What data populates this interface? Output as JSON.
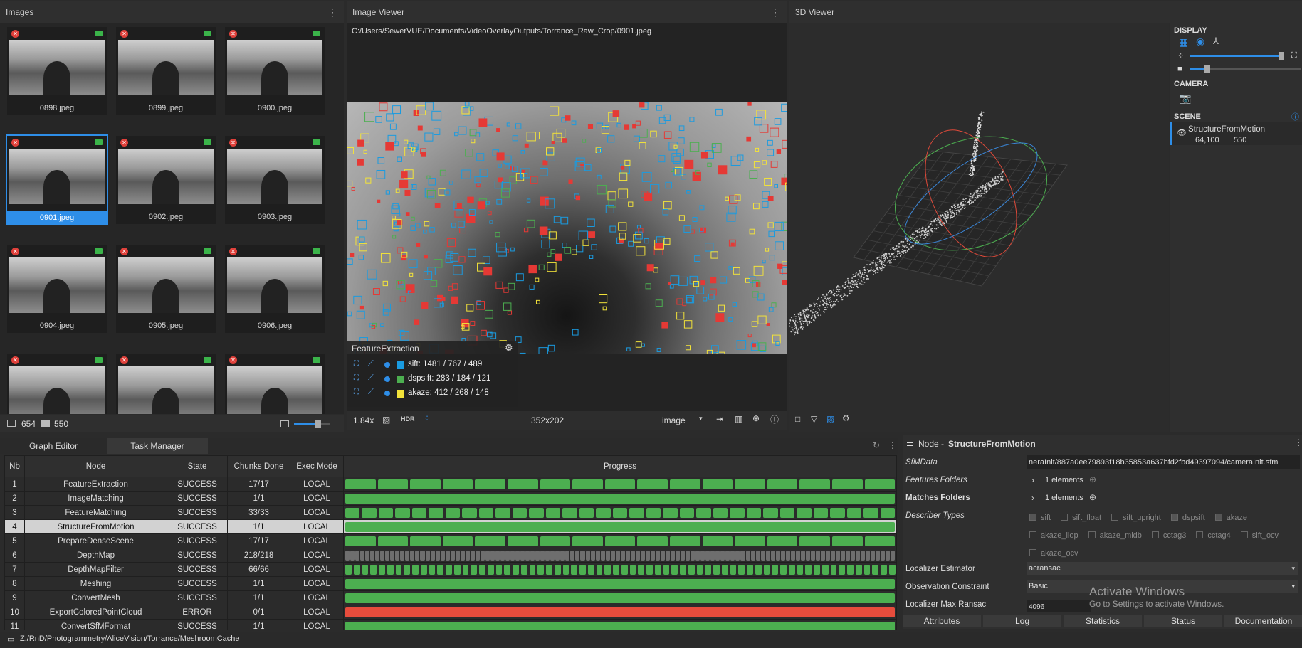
{
  "images": {
    "title": "Images",
    "count_images": "654",
    "count_cameras": "550",
    "thumbs": [
      {
        "label": "0898.jpeg"
      },
      {
        "label": "0899.jpeg"
      },
      {
        "label": "0900.jpeg"
      },
      {
        "label": "0901.jpeg",
        "selected": true
      },
      {
        "label": "0902.jpeg"
      },
      {
        "label": "0903.jpeg"
      },
      {
        "label": "0904.jpeg"
      },
      {
        "label": "0905.jpeg"
      },
      {
        "label": "0906.jpeg"
      },
      {
        "label": ""
      },
      {
        "label": ""
      },
      {
        "label": ""
      }
    ]
  },
  "image_viewer": {
    "title": "Image Viewer",
    "path": "C:/Users/SewerVUE/Documents/VideoOverlayOutputs/Torrance_Raw_Crop/0901.jpeg",
    "overlay_title": "FeatureExtraction",
    "features": [
      {
        "label": "sift: 1481 / 767 / 489",
        "color": "#1a9be0"
      },
      {
        "label": "dspsift: 283 / 184 / 121",
        "color": "#4caf50"
      },
      {
        "label": "akaze: 412 / 268 / 148",
        "color": "#f2e23a"
      }
    ],
    "zoom": "1.84x",
    "hdr": "HDR",
    "resolution": "352x202",
    "mode": "image"
  },
  "viewer3d": {
    "title": "3D Viewer",
    "display": "DISPLAY",
    "camera": "CAMERA",
    "scene": "SCENE",
    "scene_item": "StructureFromMotion",
    "points": "64,100",
    "cams": "550"
  },
  "tabs": {
    "graph_editor": "Graph Editor",
    "task_manager": "Task Manager"
  },
  "task_table": {
    "headers": [
      "Nb",
      "Node",
      "State",
      "Chunks Done",
      "Exec Mode",
      "Progress"
    ],
    "rows": [
      {
        "nb": "1",
        "node": "FeatureExtraction",
        "state": "SUCCESS",
        "chunks": "17/17",
        "mode": "LOCAL",
        "segs": 17,
        "err": false
      },
      {
        "nb": "2",
        "node": "ImageMatching",
        "state": "SUCCESS",
        "chunks": "1/1",
        "mode": "LOCAL",
        "segs": 1,
        "err": false
      },
      {
        "nb": "3",
        "node": "FeatureMatching",
        "state": "SUCCESS",
        "chunks": "33/33",
        "mode": "LOCAL",
        "segs": 33,
        "err": false
      },
      {
        "nb": "4",
        "node": "StructureFromMotion",
        "state": "SUCCESS",
        "chunks": "1/1",
        "mode": "LOCAL",
        "segs": 1,
        "err": false,
        "selected": true
      },
      {
        "nb": "5",
        "node": "PrepareDenseScene",
        "state": "SUCCESS",
        "chunks": "17/17",
        "mode": "LOCAL",
        "segs": 17,
        "err": false
      },
      {
        "nb": "6",
        "node": "DepthMap",
        "state": "SUCCESS",
        "chunks": "218/218",
        "mode": "LOCAL",
        "segs": 110,
        "err": false
      },
      {
        "nb": "7",
        "node": "DepthMapFilter",
        "state": "SUCCESS",
        "chunks": "66/66",
        "mode": "LOCAL",
        "segs": 66,
        "err": false
      },
      {
        "nb": "8",
        "node": "Meshing",
        "state": "SUCCESS",
        "chunks": "1/1",
        "mode": "LOCAL",
        "segs": 1,
        "err": false
      },
      {
        "nb": "9",
        "node": "ConvertMesh",
        "state": "SUCCESS",
        "chunks": "1/1",
        "mode": "LOCAL",
        "segs": 1,
        "err": false
      },
      {
        "nb": "10",
        "node": "ExportColoredPointCloud",
        "state": "ERROR",
        "chunks": "0/1",
        "mode": "LOCAL",
        "segs": 1,
        "err": true
      },
      {
        "nb": "11",
        "node": "ConvertSfMFormat",
        "state": "SUCCESS",
        "chunks": "1/1",
        "mode": "LOCAL",
        "segs": 1,
        "err": false
      }
    ]
  },
  "cache_path": "Z:/RnD/Photogrammetry/AliceVision/Torrance/MeshroomCache",
  "node_panel": {
    "title_prefix": "Node - ",
    "title": "StructureFromMotion",
    "sfmdata_label": "SfMData",
    "sfmdata_value": "neraInit/887a0ee79893f18b35853a637bfd2fbd49397094/cameraInit.sfm",
    "features_folders": "Features Folders",
    "features_count": "1 elements",
    "matches_folders": "Matches Folders",
    "matches_count": "1 elements",
    "describer_types": "Describer Types",
    "describers": [
      {
        "l": "sift",
        "on": true
      },
      {
        "l": "sift_float",
        "on": false
      },
      {
        "l": "sift_upright",
        "on": false
      },
      {
        "l": "dspsift",
        "on": true
      },
      {
        "l": "akaze",
        "on": true
      },
      {
        "l": "akaze_liop",
        "on": false
      },
      {
        "l": "akaze_mldb",
        "on": false
      },
      {
        "l": "cctag3",
        "on": false
      },
      {
        "l": "cctag4",
        "on": false
      },
      {
        "l": "sift_ocv",
        "on": false
      },
      {
        "l": "akaze_ocv",
        "on": false
      }
    ],
    "localizer_estimator": "Localizer Estimator",
    "localizer_value": "acransac",
    "observation": "Observation Constraint",
    "observation_value": "Basic",
    "max_ransac": "Localizer Max Ransac",
    "max_ransac_value": "4096",
    "tabs": [
      "Attributes",
      "Log",
      "Statistics",
      "Status",
      "Documentation"
    ]
  },
  "watermark": {
    "line1": "Activate Windows",
    "line2": "Go to Settings to activate Windows."
  }
}
